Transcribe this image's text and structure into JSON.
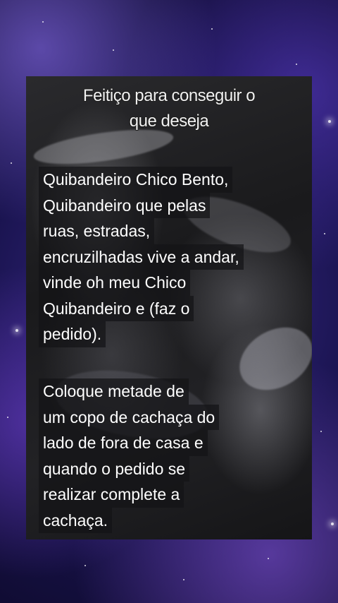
{
  "title_lines": [
    "Feitiço para conseguir o",
    "que deseja"
  ],
  "paragraph1": [
    "Quibandeiro Chico Bento,",
    "Quibandeiro que pelas",
    "ruas, estradas,",
    "encruzilhadas vive a andar,",
    "vinde oh meu Chico",
    "Quibandeiro e (faz o",
    "pedido)."
  ],
  "paragraph2": [
    "Coloque metade de",
    "um copo de cachaça do",
    "lado de fora de casa e",
    "quando o pedido se",
    "realizar complete a",
    "cachaça."
  ],
  "colors": {
    "background": "#1a1450",
    "card": "#1e1e20",
    "text": "#ffffff"
  }
}
